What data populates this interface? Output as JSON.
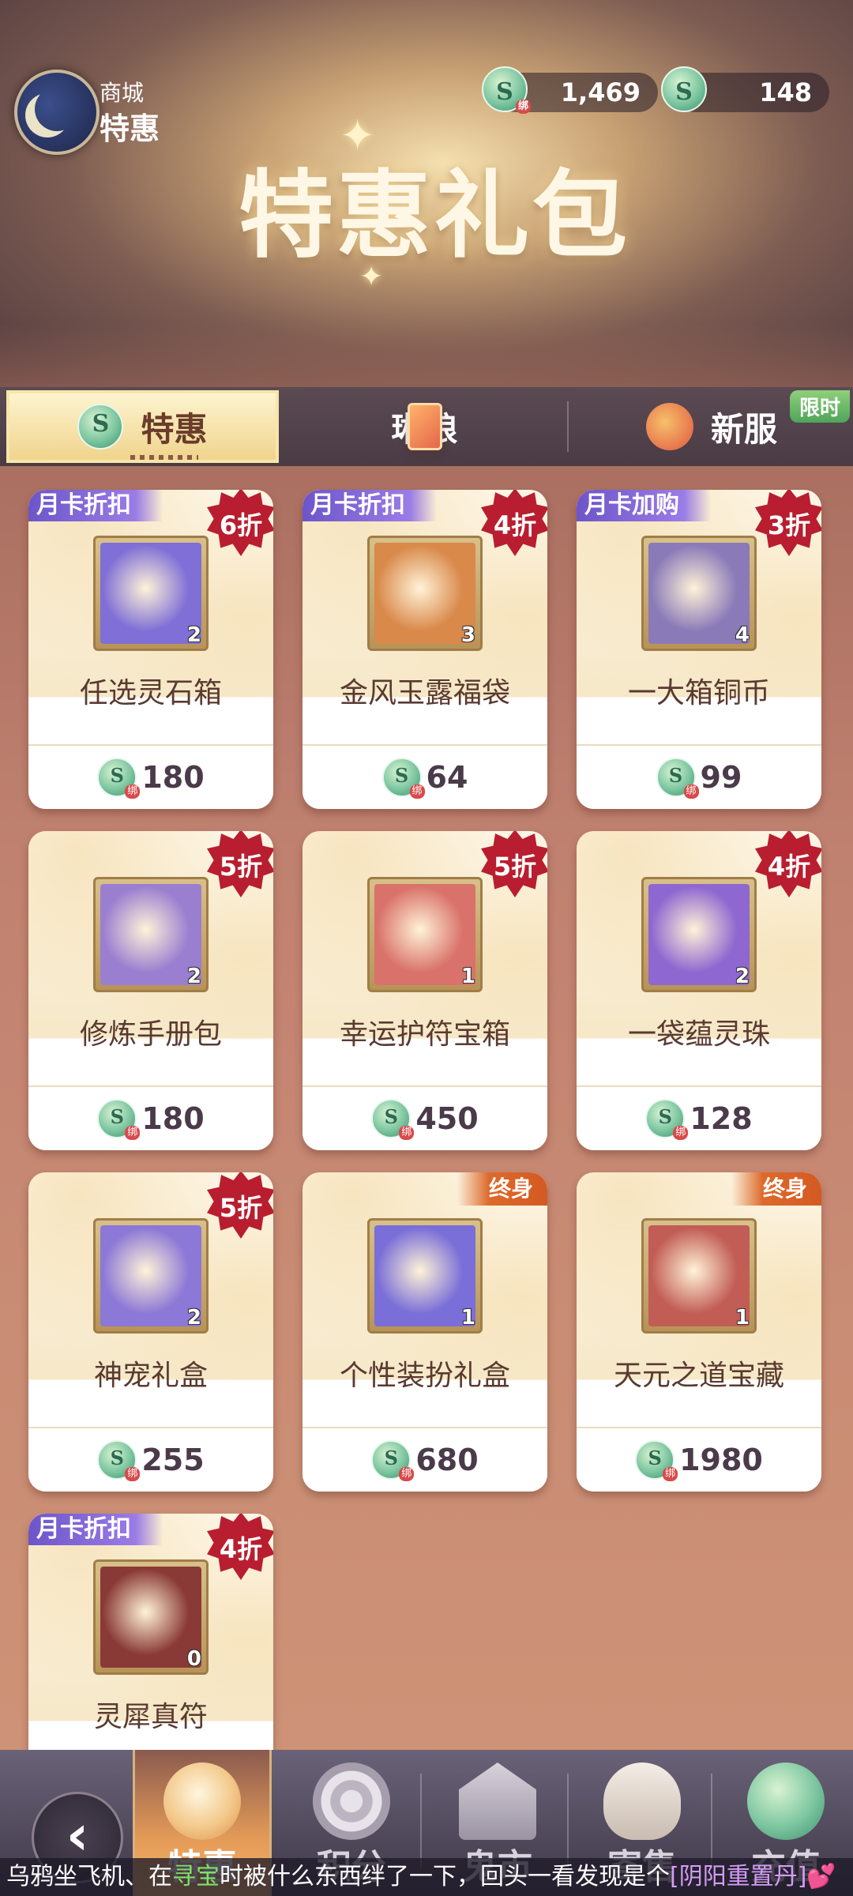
{
  "header": {
    "nav_sub": "商城",
    "nav_main": "特惠",
    "title": "特惠礼包",
    "currency_bound": "1,469",
    "currency_bound_tag": "绑",
    "currency_free": "148"
  },
  "tabs": [
    {
      "label": "特惠",
      "icon": "jade-coin-icon",
      "active": true
    },
    {
      "label": "琳琅",
      "icon": "card-icon",
      "active": false
    },
    {
      "label": "新服",
      "icon": "fox-icon",
      "active": false,
      "badge": "限时"
    }
  ],
  "cards": [
    {
      "name": "任选灵石箱",
      "price": "180",
      "count": "2",
      "ribbon": "月卡折扣",
      "discount": "6折",
      "lifetime": "",
      "item_color": "#7f6fd6"
    },
    {
      "name": "金风玉露福袋",
      "price": "64",
      "count": "3",
      "ribbon": "月卡折扣",
      "discount": "4折",
      "lifetime": "",
      "item_color": "#d9894a"
    },
    {
      "name": "一大箱铜币",
      "price": "99",
      "count": "4",
      "ribbon": "月卡加购",
      "discount": "3折",
      "lifetime": "",
      "item_color": "#8a7ab8"
    },
    {
      "name": "修炼手册包",
      "price": "180",
      "count": "2",
      "ribbon": "",
      "discount": "5折",
      "lifetime": "",
      "item_color": "#9a7fd0"
    },
    {
      "name": "幸运护符宝箱",
      "price": "450",
      "count": "1",
      "ribbon": "",
      "discount": "5折",
      "lifetime": "",
      "item_color": "#d9726a"
    },
    {
      "name": "一袋蕴灵珠",
      "price": "128",
      "count": "2",
      "ribbon": "",
      "discount": "4折",
      "lifetime": "",
      "item_color": "#8f67d0"
    },
    {
      "name": "神宠礼盒",
      "price": "255",
      "count": "2",
      "ribbon": "",
      "discount": "5折",
      "lifetime": "",
      "item_color": "#8c78d6"
    },
    {
      "name": "个性装扮礼盒",
      "price": "680",
      "count": "1",
      "ribbon": "",
      "discount": "",
      "lifetime": "终身",
      "item_color": "#7a6ed8"
    },
    {
      "name": "天元之道宝藏",
      "price": "1980",
      "count": "1",
      "ribbon": "",
      "discount": "",
      "lifetime": "终身",
      "item_color": "#c25d55"
    },
    {
      "name": "灵犀真符",
      "price": "",
      "count": "0",
      "ribbon": "月卡折扣",
      "discount": "4折",
      "lifetime": "",
      "item_color": "#8a3a36"
    }
  ],
  "bottom_nav": [
    {
      "label": "特惠",
      "icon": "gift-bag-icon",
      "active": true
    },
    {
      "label": "积分",
      "icon": "swirl-icon",
      "active": false
    },
    {
      "label": "鬼市",
      "icon": "house-icon",
      "active": false
    },
    {
      "label": "寄售",
      "icon": "ingot-icon",
      "active": false
    },
    {
      "label": "充值",
      "icon": "jade-coin-icon",
      "active": false
    }
  ],
  "ticker": {
    "part1": "乌鸦坐飞机、在",
    "highlight": "寻宝",
    "part2": "时被什么东西绊了一下，回头一看发现是个",
    "item": "[阴阳重置丹]",
    "emoji": "💕"
  },
  "colors": {
    "accent_gold": "#f0d48d",
    "discount_red": "#b81e2f",
    "ribbon_purple": "#6d55c9",
    "lifetime_orange": "#dd6a2c",
    "jade_green": "#7cc6a0"
  }
}
